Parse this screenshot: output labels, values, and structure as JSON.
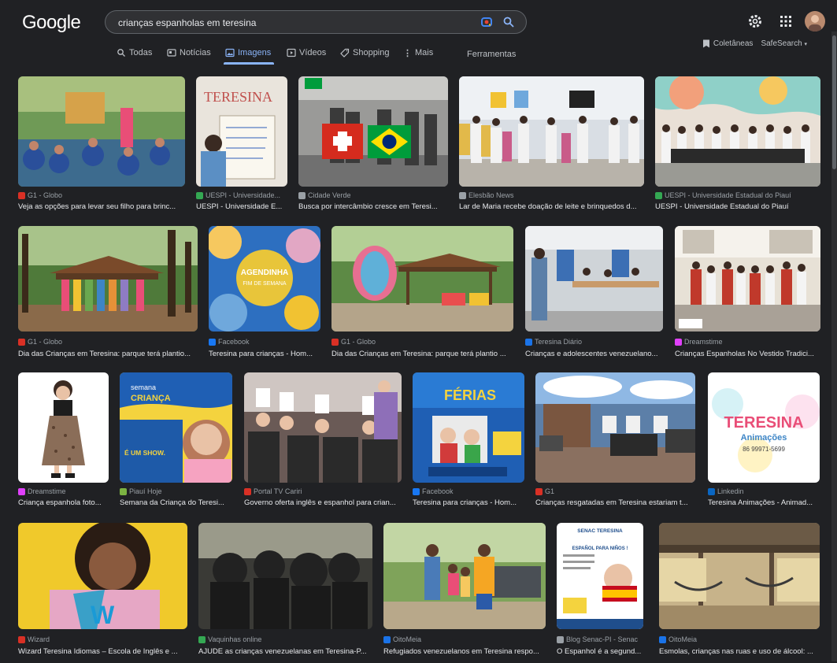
{
  "logo": "Google",
  "search": {
    "query": "crianças espanholas em teresina"
  },
  "nav": {
    "tabs": [
      {
        "label": "Todas",
        "icon": "search-icon"
      },
      {
        "label": "Notícias",
        "icon": "news-icon"
      },
      {
        "label": "Imagens",
        "icon": "image-icon",
        "active": true
      },
      {
        "label": "Vídeos",
        "icon": "play-icon"
      },
      {
        "label": "Shopping",
        "icon": "tag-icon"
      },
      {
        "label": "Mais",
        "icon": "more-vert-icon"
      }
    ],
    "tools": "Ferramentas",
    "collections": "Coletâneas",
    "safesearch": "SafeSearch"
  },
  "colors": {
    "accent": "#8ab4f8",
    "background": "#202124"
  },
  "results": [
    {
      "source": "G1 - Globo",
      "title": "Veja as opções para levar seu filho para brinc...",
      "favicon": "#d93025"
    },
    {
      "source": "UESPI - Universidade...",
      "title": "UESPI - Universidade E...",
      "favicon": "#34a853"
    },
    {
      "source": "Cidade Verde",
      "title": "Busca por intercâmbio cresce em Teresi...",
      "favicon": "#9aa0a6"
    },
    {
      "source": "Elesbão News",
      "title": "Lar de Maria recebe doação de leite e brinquedos d...",
      "favicon": "#9aa0a6"
    },
    {
      "source": "UESPI - Universidade Estadual do Piauí",
      "title": "UESPI - Universidade Estadual do Piauí",
      "favicon": "#34a853"
    },
    {
      "source": "G1 - Globo",
      "title": "Dia das Crianças em Teresina: parque terá plantio...",
      "favicon": "#d93025"
    },
    {
      "source": "Facebook",
      "title": "Teresina para crianças - Hom...",
      "favicon": "#1877f2"
    },
    {
      "source": "G1 - Globo",
      "title": "Dia das Crianças em Teresina: parque terá plantio ...",
      "favicon": "#d93025"
    },
    {
      "source": "Teresina Diário",
      "title": "Crianças e adolescentes venezuelano...",
      "favicon": "#1a73e8"
    },
    {
      "source": "Dreamstime",
      "title": "Crianças Espanholas No Vestido Tradici...",
      "favicon": "#e040fb"
    },
    {
      "source": "Dreamstime",
      "title": "Criança espanhola foto...",
      "favicon": "#e040fb"
    },
    {
      "source": "Piauí Hoje",
      "title": "Semana da Criança do Teresi...",
      "favicon": "#7cb342"
    },
    {
      "source": "Portal TV Cariri",
      "title": "Governo oferta inglês e espanhol para crian...",
      "favicon": "#d93025"
    },
    {
      "source": "Facebook",
      "title": "Teresina para crianças - Hom...",
      "favicon": "#1877f2"
    },
    {
      "source": "G1",
      "title": "Crianças resgatadas em Teresina estariam t...",
      "favicon": "#d93025"
    },
    {
      "source": "Linkedin",
      "title": "Teresina Animações - Animad...",
      "favicon": "#0a66c2"
    },
    {
      "source": "Wizard",
      "title": "Wizard Teresina Idiomas – Escola de Inglês e ...",
      "favicon": "#d93025"
    },
    {
      "source": "Vaquinhas online",
      "title": "AJUDE as crianças venezuelanas em Teresina-P...",
      "favicon": "#34a853"
    },
    {
      "source": "OitoMeia",
      "title": "Refugiados venezuelanos em Teresina respo...",
      "favicon": "#1a73e8"
    },
    {
      "source": "Blog Senac-PI - Senac",
      "title": "O Espanhol é a segund...",
      "favicon": "#9aa0a6"
    },
    {
      "source": "OitoMeia",
      "title": "Esmolas, crianças nas ruas e uso de álcool: ...",
      "favicon": "#1a73e8"
    }
  ],
  "image_texts": {
    "teresina_board": "TERESINA",
    "agendinha": "AGENDINHA",
    "agendinha_sub": "FIM DE SEMANA",
    "semana": "semana",
    "crianca": "CRIANÇA",
    "eshow": "É UM SHOW.",
    "ferias": "FÉRIAS",
    "animacoes_title": "TERESINA",
    "animacoes_sub": "Animações",
    "animacoes_phone": "86 99971-5699",
    "senac_title": "SENAC TERESINA",
    "senac_sub": "ESPAÑOL PARA NIÑOS !",
    "wizard_letter": "W"
  }
}
